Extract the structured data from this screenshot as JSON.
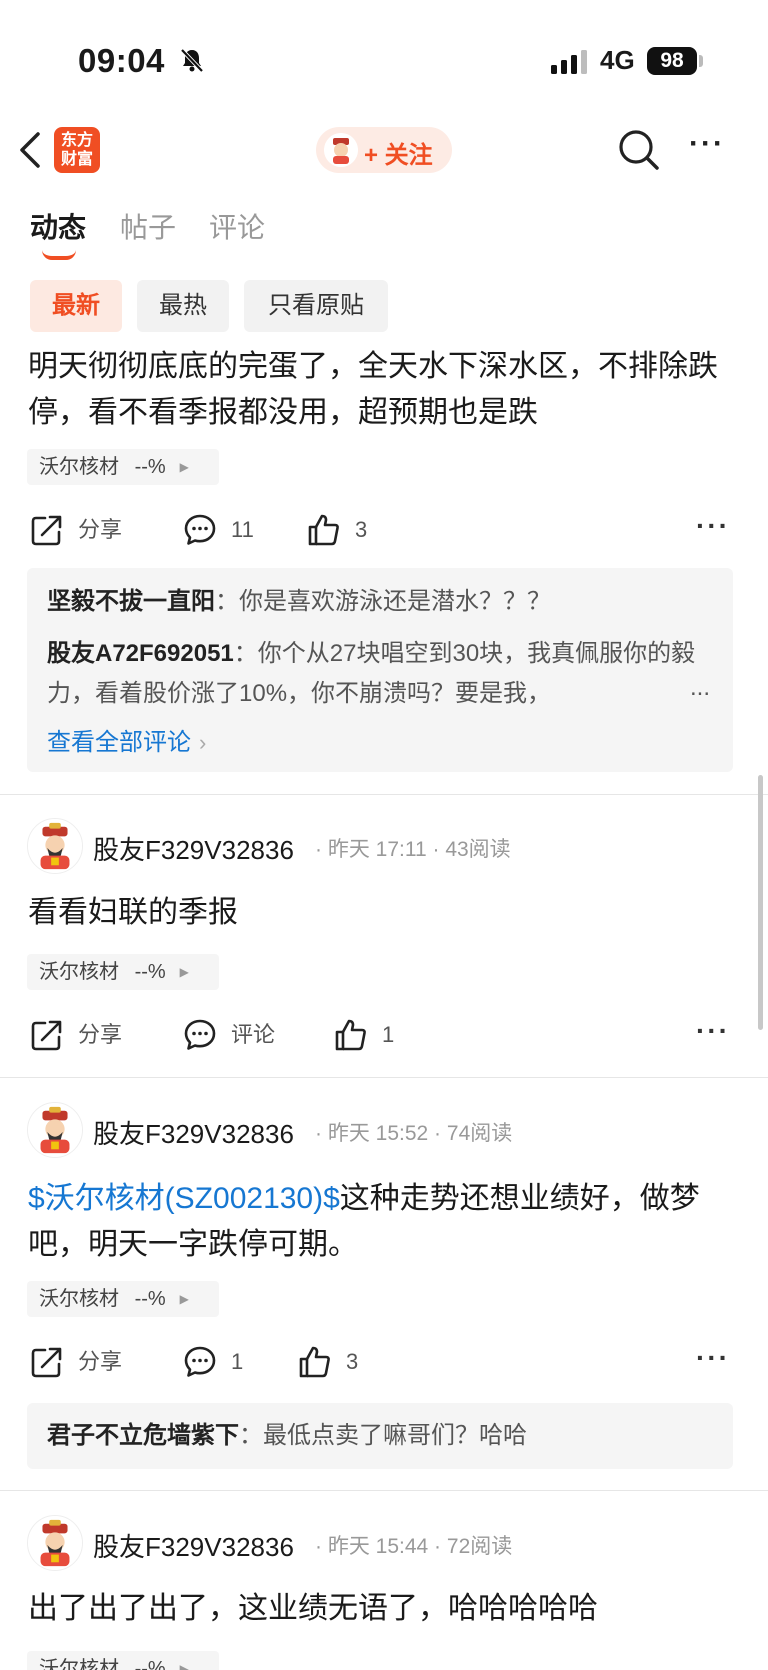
{
  "status_bar": {
    "time": "09:04",
    "network": "4G",
    "battery": "98"
  },
  "nav": {
    "brand_logo_text_1": "东方",
    "brand_logo_text_2": "财富",
    "follow_label": "+ 关注"
  },
  "tabs": [
    {
      "label": "动态"
    },
    {
      "label": "帖子"
    },
    {
      "label": "评论"
    }
  ],
  "filters": [
    {
      "label": "最新"
    },
    {
      "label": "最热"
    },
    {
      "label": "只看原贴"
    }
  ],
  "posts": [
    {
      "text": "明天彻彻底底的完蛋了，全天水下深水区，不排除跌停，看不看季报都没用，超预期也是跌",
      "tag": {
        "name": "沃尔核材",
        "change": "--%"
      },
      "share": "分享",
      "comments": "11",
      "likes": "3",
      "replies": [
        {
          "user": "坚毅不拔一直阳",
          "text": "你是喜欢游泳还是潜水？？？"
        },
        {
          "user": "股友A72F692051",
          "text": "你个从27块唱空到30块，我真佩服你的毅力，看着股价涨了10%，你不崩溃吗？要是我，",
          "ellipsis": "..."
        }
      ],
      "see_all": "查看全部评论"
    },
    {
      "author": "股友F329V32836",
      "time": "昨天 17:11",
      "reads": "43阅读",
      "text": "看看妇联的季报",
      "tag": {
        "name": "沃尔核材",
        "change": "--%"
      },
      "share": "分享",
      "comments": "评论",
      "likes": "1"
    },
    {
      "author": "股友F329V32836",
      "time": "昨天 15:52",
      "reads": "74阅读",
      "link": "$沃尔核材(SZ002130)$",
      "text": "这种走势还想业绩好，做梦吧，明天一字跌停可期。",
      "tag": {
        "name": "沃尔核材",
        "change": "--%"
      },
      "share": "分享",
      "comments": "1",
      "likes": "3",
      "replies": [
        {
          "user": "君子不立危墙紫下",
          "text": "最低点卖了嘛哥们？哈哈"
        }
      ]
    },
    {
      "author": "股友F329V32836",
      "time": "昨天 15:44",
      "reads": "72阅读",
      "text": "出了出了出了，这业绩无语了，哈哈哈哈哈",
      "tag": {
        "name": "沃尔核材",
        "change": "--%"
      }
    }
  ],
  "colors": {
    "accent": "#f04e23",
    "link": "#1677d2"
  }
}
